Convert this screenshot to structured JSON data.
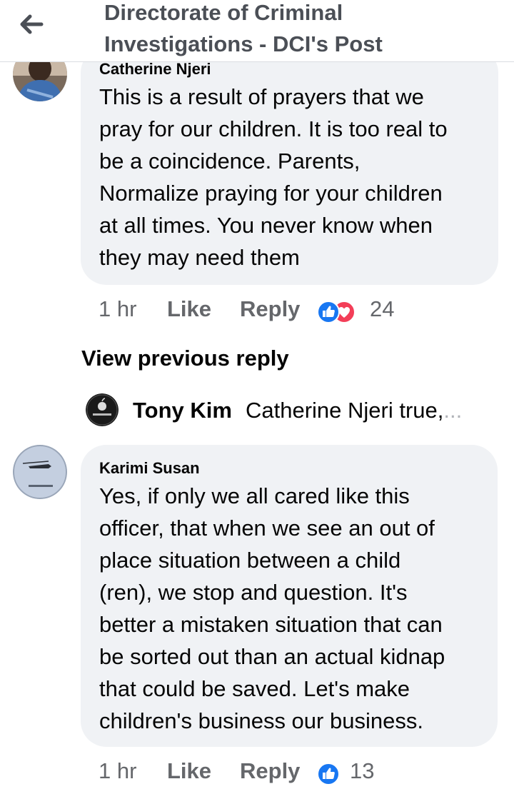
{
  "header": {
    "back_icon": "arrow-left-icon",
    "title_line1": "Directorate of Criminal",
    "title_line2": "Investigations - DCI's Post"
  },
  "comments": [
    {
      "author": "Catherine Njeri",
      "lines": [
        "This is a result of prayers that we",
        "pray for our children. It is too real to",
        "be a coincidence. Parents,",
        "Normalize praying for your children",
        "at all times. You never know when",
        "they may need them"
      ],
      "time": "1 hr",
      "like_label": "Like",
      "reply_label": "Reply",
      "reactions": [
        "like-reaction-icon",
        "love-reaction-icon"
      ],
      "reaction_count": "24"
    },
    {
      "author": "Karimi Susan",
      "lines": [
        "Yes, if only we all cared like this",
        "officer, that when we see an out of",
        "place situation between a child",
        "(ren), we stop and question. It's",
        "better a mistaken situation that can",
        "be sorted out than an actual kidnap",
        "that could be saved. Let's make",
        "children's business our business."
      ],
      "time": "1 hr",
      "like_label": "Like",
      "reply_label": "Reply",
      "reactions": [
        "like-reaction-icon"
      ],
      "reaction_count": "13"
    }
  ],
  "view_previous": "View previous reply",
  "reply_preview": {
    "name": "Tony Kim",
    "text": "Catherine Njeri true,",
    "ellipsis": "..."
  },
  "colors": {
    "like_blue": "#1877f2",
    "love_red": "#f33e58",
    "bubble_bg": "#f0f2f5",
    "secondary_text": "#65676b"
  }
}
